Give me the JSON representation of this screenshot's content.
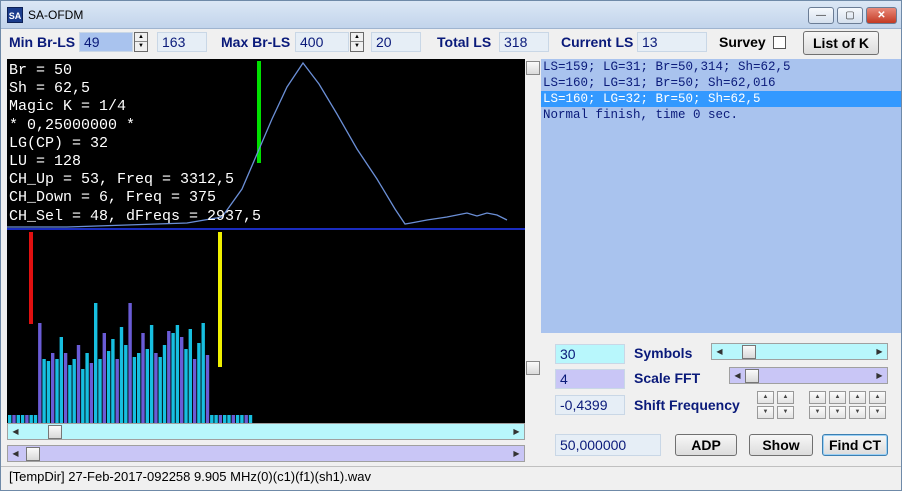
{
  "window": {
    "title": "SA-OFDM",
    "icon_text": "SA"
  },
  "toolbar": {
    "min_br_ls_label": "Min Br-LS",
    "min_br_ls_value": "49",
    "min_br_ls_readout": "163",
    "max_br_ls_label": "Max Br-LS",
    "max_br_ls_value": "400",
    "max_br_ls_readout": "20",
    "total_ls_label": "Total LS",
    "total_ls_value": "318",
    "current_ls_label": "Current LS",
    "current_ls_value": "13",
    "survey_label": "Survey",
    "survey_checked": false,
    "list_of_k_label": "List of K"
  },
  "plot": {
    "lines": [
      "Br = 50",
      "Sh = 62,5",
      "Magic K = 1/4",
      "* 0,25000000 *",
      "LG(CP) = 32",
      "LU = 128",
      "CH_Up = 53, Freq = 3312,5",
      "CH_Down = 6, Freq = 375",
      "CH_Sel = 48, dFreqs = 2937,5"
    ],
    "colors": {
      "curve": "#6b8fd6",
      "marker": "#00e000",
      "separator": "#1a2cc0",
      "left_marker": "#e01010",
      "right_marker": "#f0f000",
      "bar_cyan": "#17bfe0",
      "bar_purple": "#6a5cd6"
    }
  },
  "log": {
    "lines": [
      "LS=159; LG=31; Br=50,314; Sh=62,5",
      "LS=160; LG=31; Br=50; Sh=62,016",
      "LS=160; LG=32; Br=50; Sh=62,5",
      "Normal finish, time 0 sec."
    ],
    "selected_index": 2
  },
  "controls": {
    "symbols_value": "30",
    "symbols_label": "Symbols",
    "symbols_level": 0.12,
    "scale_fft_value": "4",
    "scale_fft_label": "Scale FFT",
    "scale_fft_level": 0.0,
    "shift_value": "-0,4399",
    "shift_label": "Shift Frequency",
    "freq_value": "50,000000",
    "adp_label": "ADP",
    "show_label": "Show",
    "find_ct_label": "Find CT"
  },
  "status": {
    "text": "[TempDir] 27-Feb-2017-092258 9.905 MHz(0)(c1)(f1)(sh1).wav"
  }
}
